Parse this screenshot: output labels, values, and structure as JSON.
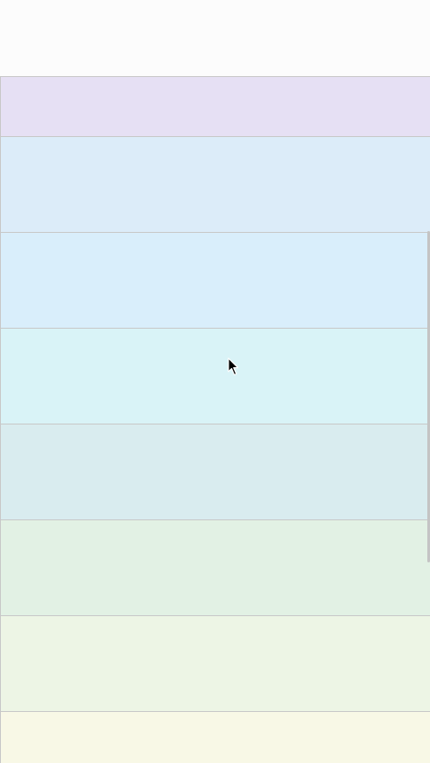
{
  "app": {
    "background": "#fcfcfc",
    "divider_color": "#c8c8c8"
  },
  "bands": [
    {
      "color": "#e6e0f4"
    },
    {
      "color": "#dcecf9"
    },
    {
      "color": "#d9eefb"
    },
    {
      "color": "#d9f3f7"
    },
    {
      "color": "#d9ecef"
    },
    {
      "color": "#e2f1e4"
    },
    {
      "color": "#edf5e5"
    },
    {
      "color": "#f8f8e6"
    }
  ],
  "pointer": {
    "icon": "mouse-pointer-icon"
  }
}
